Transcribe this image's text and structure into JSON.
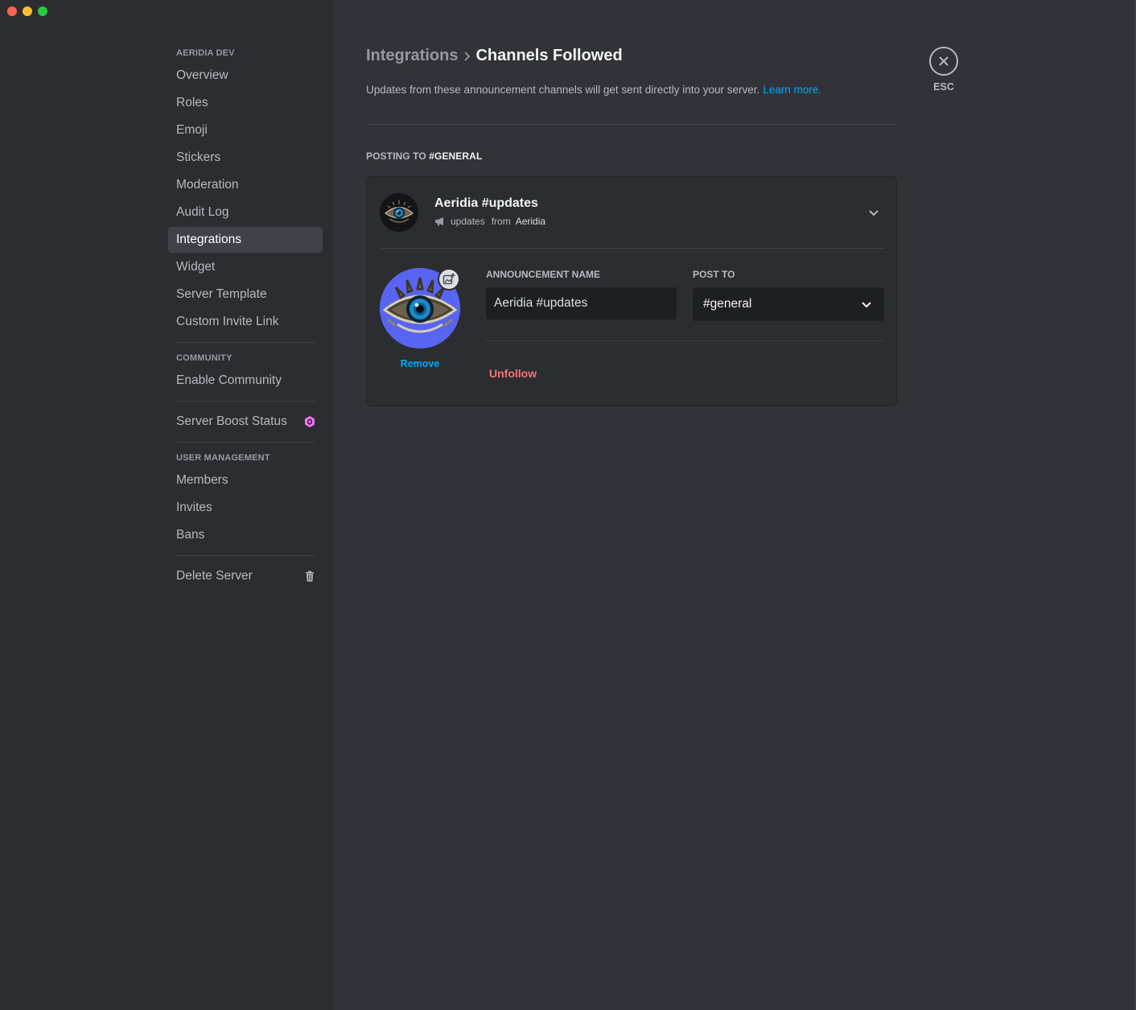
{
  "window": {
    "traffic_lights": [
      "close",
      "minimize",
      "zoom"
    ]
  },
  "sidebar": {
    "server_section": {
      "header": "AERIDIA DEV",
      "items": [
        {
          "label": "Overview"
        },
        {
          "label": "Roles"
        },
        {
          "label": "Emoji"
        },
        {
          "label": "Stickers"
        },
        {
          "label": "Moderation"
        },
        {
          "label": "Audit Log"
        },
        {
          "label": "Integrations",
          "selected": true
        },
        {
          "label": "Widget"
        },
        {
          "label": "Server Template"
        },
        {
          "label": "Custom Invite Link"
        }
      ]
    },
    "community_section": {
      "header": "COMMUNITY",
      "items": [
        {
          "label": "Enable Community"
        }
      ]
    },
    "boost": {
      "label": "Server Boost Status",
      "icon": "boost-gem-icon",
      "icon_color": "#ff73fa"
    },
    "user_management_section": {
      "header": "USER MANAGEMENT",
      "items": [
        {
          "label": "Members"
        },
        {
          "label": "Invites"
        },
        {
          "label": "Bans"
        }
      ]
    },
    "delete": {
      "label": "Delete Server",
      "icon": "trash-icon"
    }
  },
  "main": {
    "breadcrumb": {
      "parent": "Integrations",
      "separator_icon": "chevron-right-icon",
      "current": "Channels Followed"
    },
    "description": {
      "text": "Updates from these announcement channels will get sent directly into your server.",
      "link": "Learn more."
    },
    "posting_to": {
      "prefix": "POSTING TO",
      "channel": "#GENERAL"
    },
    "follow_card": {
      "title": "Aeridia #updates",
      "channel_icon": "announcement-megaphone-icon",
      "channel": "updates",
      "from_label": "from",
      "guild": "Aeridia",
      "expanded": true,
      "avatar_remove_label": "Remove",
      "announcement_name_label": "ANNOUNCEMENT NAME",
      "announcement_name_value": "Aeridia #updates",
      "post_to_label": "POST TO",
      "post_to_value": "#general",
      "unfollow_label": "Unfollow"
    }
  },
  "close": {
    "icon": "close-x-icon",
    "label": "ESC"
  },
  "colors": {
    "background": "#313338",
    "sidebar": "#2b2d31",
    "selected": "#404249",
    "link": "#00a8fc",
    "danger": "#f87276",
    "blurple": "#5865f2"
  }
}
